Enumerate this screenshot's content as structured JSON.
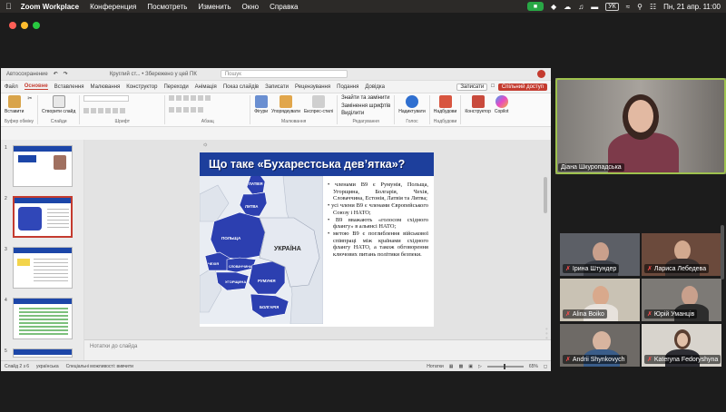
{
  "menubar": {
    "app": "Zoom Workplace",
    "items": [
      "Конференция",
      "Посмотреть",
      "Изменить",
      "Окно",
      "Справка"
    ],
    "keyboard": "УК",
    "datetime": "Пн, 21 апр.  11:00"
  },
  "ppt": {
    "autosave": "Автосохранение",
    "filename": "Круглий ст... • Збережено у цей ПК",
    "search_placeholder": "Пошук",
    "tabs": [
      "Файл",
      "Основне",
      "Вставлення",
      "Малювання",
      "Конструктор",
      "Переходи",
      "Анімація",
      "Показ слайдів",
      "Записати",
      "Рецензування",
      "Подання",
      "Довідка"
    ],
    "active_tab": "Основне",
    "record_btn": "Записати",
    "share_btn": "Спільний доступ",
    "ribbon": {
      "paste": "Вставити",
      "clipboard": "Буфер обміну",
      "new_slide": "Створити слайд",
      "slides": "Слайди",
      "font": "Шрифт",
      "paragraph": "Абзац",
      "shapes": "Фігури",
      "arrange": "Упорядкувати",
      "quick_styles": "Експрес-стилі",
      "drawing": "Малювання",
      "find": "Знайти та замінити",
      "replace_fonts": "Замінення шрифтів",
      "select": "Виділити",
      "editing": "Редагування",
      "dictate": "Надиктувати",
      "voice": "Голос",
      "addins": "Надбудови",
      "addins_group": "Надбудови",
      "designer": "Конструктор",
      "copilot": "Copilot"
    },
    "slide_numbers": [
      "1",
      "2",
      "3",
      "4",
      "5"
    ],
    "slide": {
      "title": "Що таке «Бухарестська дев’ятка»?",
      "countries": [
        "ЛАТВІЯ",
        "ЛИТВА",
        "ПОЛЬЩА",
        "ЧЕХІЯ",
        "СЛОВАЧЧИНА",
        "УГОРЩИНА",
        "РУМУНІЯ",
        "БОЛГАРІЯ",
        "УКРАЇНА"
      ],
      "bullets": [
        "членами В9 є Румунія, Польща, Угорщина, Болгарія, Чехія, Словаччина, Естонія, Латвія та Литва;",
        "усі члени В9 є членами Європейського Союзу і НАТО;",
        "В9 вважають «голосом східного флангу» в альянсі НАТО;",
        "метою В9 є поглиблення військової співпраці між країнами східного флангу НАТО, а також обговорення ключових питань політики безпеки."
      ]
    },
    "notes_placeholder": "Нотатки до слайда",
    "status": {
      "slide": "Слайд 2 з 6",
      "lang": "українська",
      "accessibility": "Спеціальні можливості: вивчити",
      "notes": "Нотатки",
      "zoom": "65%"
    }
  },
  "participants": [
    {
      "name": "Діана Шкуропадська",
      "muted": false
    },
    {
      "name": "Ірина Штундер",
      "muted": true
    },
    {
      "name": "Лариса Лебедева",
      "muted": true
    },
    {
      "name": "Alina Boiko",
      "muted": true
    },
    {
      "name": "Юрій Уманців",
      "muted": true
    },
    {
      "name": "Andrii Shynkovych",
      "muted": true
    },
    {
      "name": "Kateryna Fedoryshyna",
      "muted": true
    }
  ],
  "colors": {
    "accent": "#c43b2f",
    "slide_blue": "#1d3f9c",
    "speaker_frame": "#9ec14e"
  }
}
